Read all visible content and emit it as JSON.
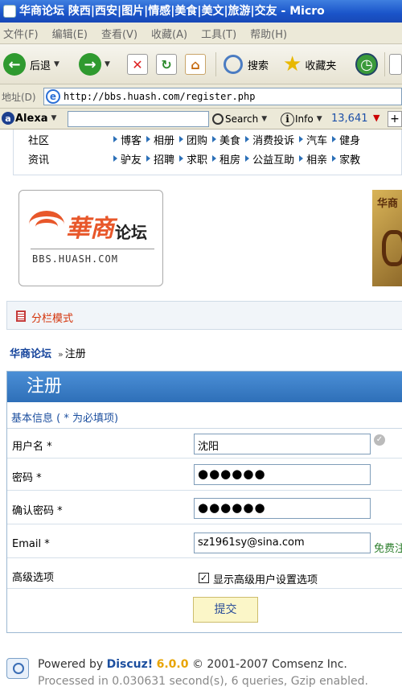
{
  "window": {
    "title": "华商论坛 陕西|西安|图片|情感|美食|美文|旅游|交友 - Micro"
  },
  "menu": [
    "文件(F)",
    "编辑(E)",
    "查看(V)",
    "收藏(A)",
    "工具(T)",
    "帮助(H)"
  ],
  "toolbar": {
    "back_label": "后退",
    "search_label": "搜索",
    "favorites_label": "收藏夹"
  },
  "address": {
    "label": "地址(D)",
    "url": "http://bbs.huash.com/register.php"
  },
  "alexa": {
    "brand": "Alexa",
    "search_value": "",
    "search_label": "Search",
    "info_label": "Info",
    "rank": "13,641"
  },
  "nav": {
    "rows": [
      {
        "category": "社区",
        "items": [
          "博客",
          "相册",
          "团购",
          "美食",
          "消费投诉",
          "汽车",
          "健身"
        ]
      },
      {
        "category": "资讯",
        "items": [
          "驴友",
          "招聘",
          "求职",
          "租房",
          "公益互助",
          "相亲",
          "家教"
        ]
      }
    ]
  },
  "logo": {
    "cn_main": "華商",
    "cn_sub": "论坛",
    "domain_text": "BBS.HUASH.COM"
  },
  "ad": {
    "text": "华商"
  },
  "mode": {
    "label": "分栏模式"
  },
  "breadcrumb": {
    "home": "华商论坛",
    "separator": "»",
    "current": "注册"
  },
  "register": {
    "title": "注册",
    "subtitle": "基本信息 ( * 为必填项)",
    "fields": {
      "username": {
        "label": "用户名 *",
        "value": "沈阳"
      },
      "password": {
        "label": "密码 *",
        "value": "●●●●●●"
      },
      "confirm": {
        "label": "确认密码 *",
        "value": "●●●●●●"
      },
      "email": {
        "label": "Email *",
        "value": "sz1961sy@sina.com",
        "side_link": "免费注"
      }
    },
    "advanced": {
      "label": "高级选项",
      "checkbox_label": "显示高级用户设置选项",
      "checked": true
    },
    "submit_label": "提交"
  },
  "footer": {
    "powered_prefix": "Powered by",
    "product": "Discuz!",
    "version": "6.0.0",
    "copyright": "© 2001-2007 Comsenz Inc.",
    "processed": "Processed in 0.030631 second(s), 6 queries, Gzip enabled."
  }
}
